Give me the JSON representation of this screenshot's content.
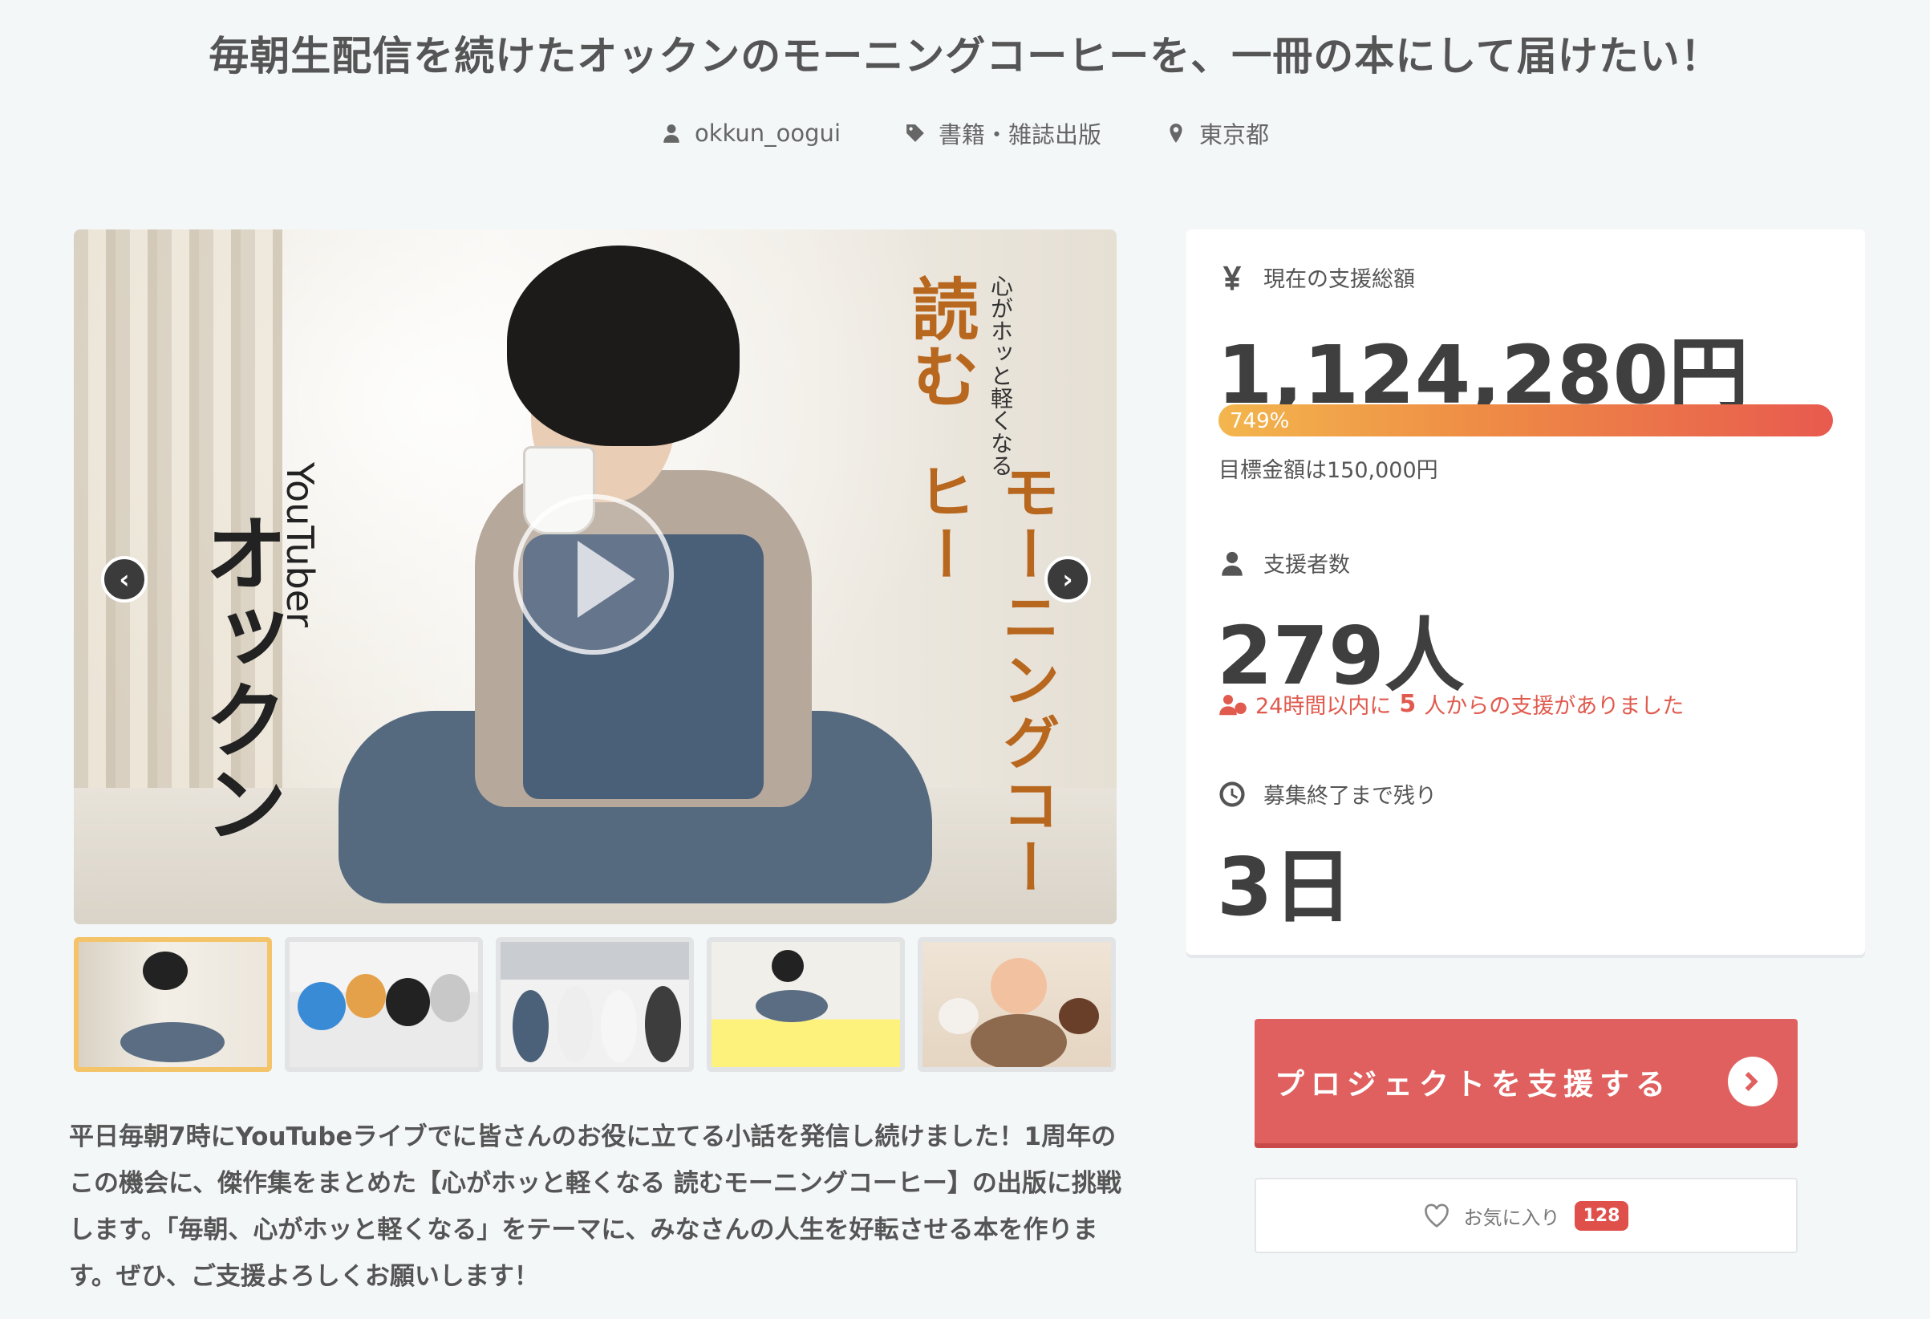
{
  "title": "毎朝生配信を続けたオックンのモーニングコーヒーを、一冊の本にして届けたい！",
  "meta": {
    "author": "okkun_oogui",
    "category": "書籍・雑誌出版",
    "location": "東京都"
  },
  "hero": {
    "subtitle_right": "心がホッと軽くなる",
    "title_read": "読む",
    "title_book": "モーニングコーヒー",
    "label_youtuber": "YouTuber",
    "label_name": "オックン"
  },
  "thumbnails": [
    "cover-photo",
    "group-photo-1",
    "group-photo-2",
    "cover-yellow",
    "cake-photo"
  ],
  "description": "平日毎朝7時にYouTubeライブでに皆さんのお役に立てる小話を発信し続けました！1周年のこの機会に、傑作集をまとめた【心がホッと軽くなる 読むモーニングコーヒー】の出版に挑戦します。「毎朝、心がホッと軽くなる」をテーマに、みなさんの人生を好転させる本を作ります。ぜひ、ご支援よろしくお願いします！",
  "stats": {
    "total_label": "現在の支援総額",
    "total_value": "1,124,280円",
    "progress_label": "749%",
    "progress_ratio": 7.49,
    "goal_text": "目標金額は150,000円",
    "backers_label": "支援者数",
    "backers_value": "279人",
    "recent_prefix": "24時間以内に",
    "recent_count": "5",
    "recent_suffix": "人からの支援がありました",
    "remaining_label": "募集終了まで残り",
    "remaining_value": "3日"
  },
  "actions": {
    "support_label": "プロジェクトを支援する",
    "favorite_label": "お気に入り",
    "favorite_count": "128"
  },
  "colors": {
    "accent": "#e0605f",
    "progress_start": "#f3b64d",
    "progress_end": "#e85a4f",
    "thumb_active": "#f3c46a"
  }
}
